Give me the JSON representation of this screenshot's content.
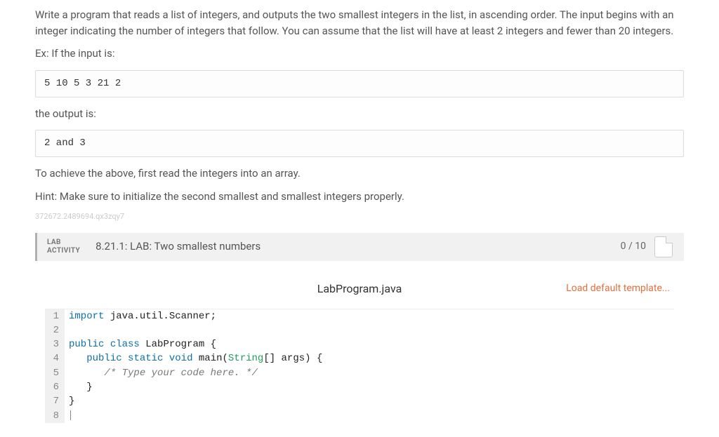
{
  "intro": {
    "p1": "Write a program that reads a list of integers, and outputs the two smallest integers in the list, in ascending order. The input begins with an integer indicating the number of integers that follow. You can assume that the list will have at least 2 integers and fewer than 20 integers.",
    "p2": "Ex: If the input is:",
    "input_example": "5 10 5 3 21 2",
    "p3": "the output is:",
    "output_example": "2 and 3",
    "p4": "To achieve the above, first read the integers into an array.",
    "p5": "Hint: Make sure to initialize the second smallest and smallest integers properly.",
    "watermark": "372672.2489694.qx3zqy7"
  },
  "lab": {
    "badge_line1": "LAB",
    "badge_line2": "ACTIVITY",
    "title": "8.21.1: LAB: Two smallest numbers",
    "score": "0 / 10"
  },
  "editor": {
    "filename": "LabProgram.java",
    "load_template": "Load default template...",
    "lines": [
      {
        "n": "1",
        "html": "<span class='kw1'>import</span> java.util.Scanner;"
      },
      {
        "n": "2",
        "html": ""
      },
      {
        "n": "3",
        "html": "<span class='kw1'>public</span> <span class='kw1'>class</span> LabProgram {"
      },
      {
        "n": "4",
        "html": "   <span class='kw1'>public</span> <span class='kw1'>static</span> <span class='kw1'>void</span> main(<span class='typ'>String</span>[] args) {"
      },
      {
        "n": "5",
        "html": "      <span class='cmt'>/* Type your code here. */</span>"
      },
      {
        "n": "6",
        "html": "   }"
      },
      {
        "n": "7",
        "html": "}"
      },
      {
        "n": "8",
        "html": "<span class='cursor'></span>"
      }
    ]
  }
}
